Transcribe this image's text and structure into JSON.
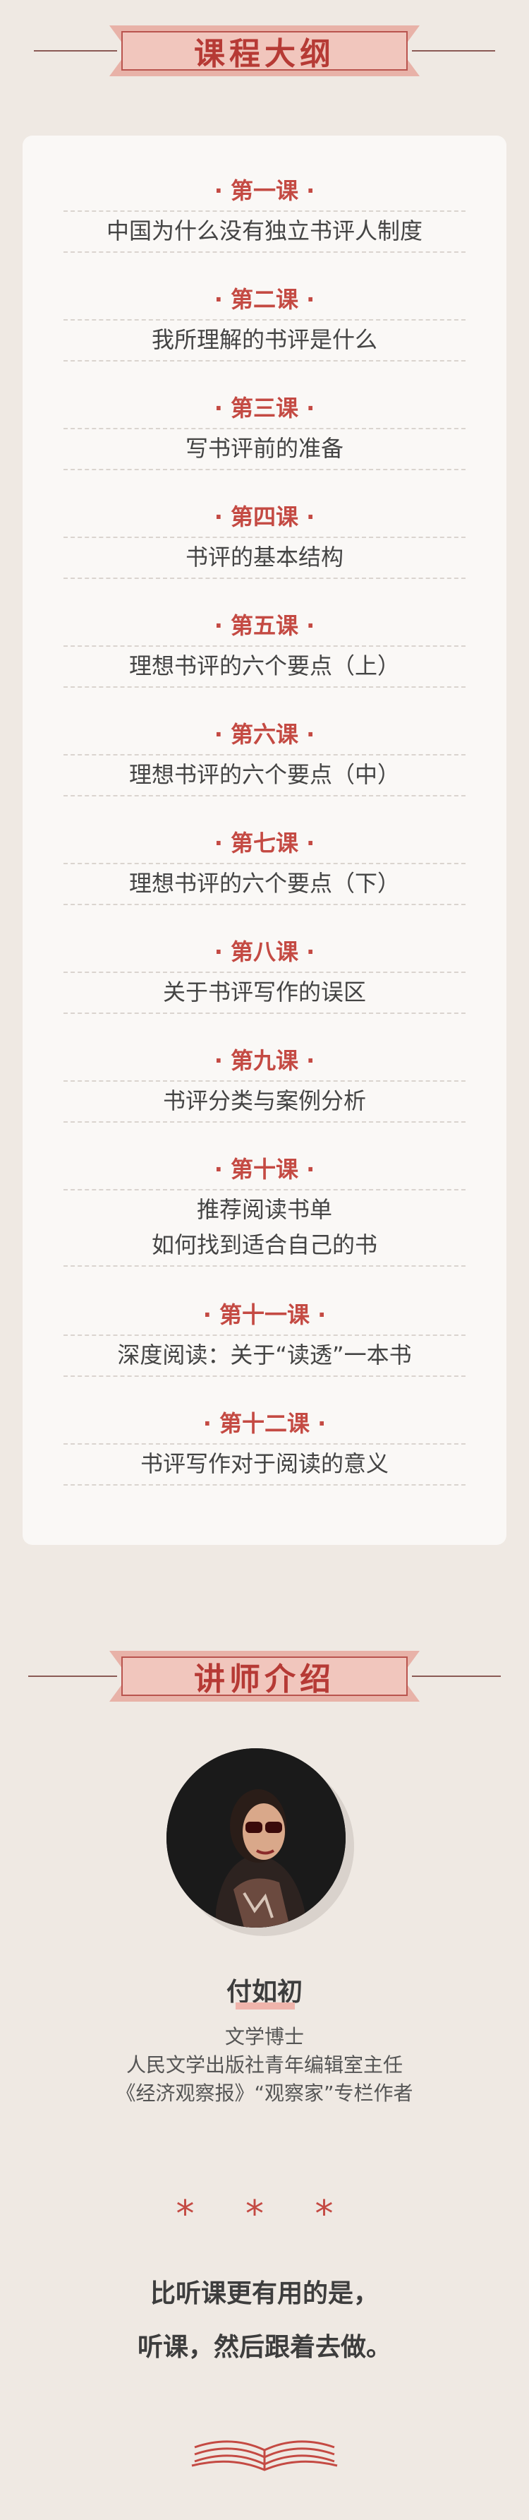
{
  "outline": {
    "title": "课程大纲",
    "lessons": [
      {
        "num": "· 第一课 ·",
        "text": [
          "中国为什么没有独立书评人制度"
        ]
      },
      {
        "num": "· 第二课 ·",
        "text": [
          "我所理解的书评是什么"
        ]
      },
      {
        "num": "· 第三课 ·",
        "text": [
          "写书评前的准备"
        ]
      },
      {
        "num": "· 第四课 ·",
        "text": [
          "书评的基本结构"
        ]
      },
      {
        "num": "· 第五课 ·",
        "text": [
          "理想书评的六个要点（上）"
        ]
      },
      {
        "num": "· 第六课 ·",
        "text": [
          "理想书评的六个要点（中）"
        ]
      },
      {
        "num": "· 第七课 ·",
        "text": [
          "理想书评的六个要点（下）"
        ]
      },
      {
        "num": "· 第八课 ·",
        "text": [
          "关于书评写作的误区"
        ]
      },
      {
        "num": "· 第九课 ·",
        "text": [
          "书评分类与案例分析"
        ]
      },
      {
        "num": "· 第十课 ·",
        "text": [
          "推荐阅读书单",
          "如何找到适合自己的书"
        ]
      },
      {
        "num": "· 第十一课 ·",
        "text": [
          "深度阅读：关于“读透”一本书"
        ]
      },
      {
        "num": "· 第十二课 ·",
        "text": [
          "书评写作对于阅读的意义"
        ]
      }
    ]
  },
  "teacher": {
    "title": "讲师介绍",
    "name": "付如初",
    "info": [
      "文学博士",
      "人民文学出版社青年编辑室主任",
      "《经济观察报》“观察家”专栏作者"
    ]
  },
  "footer": {
    "stars": "* * *",
    "slogan": [
      "比听课更有用的是，",
      "听课，然后跟着去做。"
    ]
  },
  "icons": {
    "book": "open-book-icon"
  },
  "colors": {
    "accent": "#c44a43",
    "ribbon": "#f1c6bd",
    "background": "#efe9e3",
    "card": "#faf8f6"
  }
}
